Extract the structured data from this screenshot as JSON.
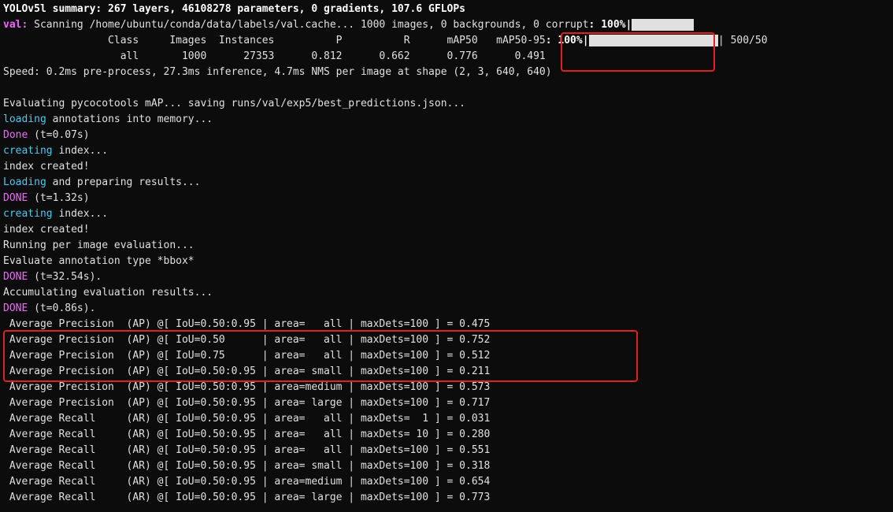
{
  "summary": "YOLOv5l summary: 267 layers, 46108278 parameters, 0 gradients, 107.6 GFLOPs",
  "val_label": "val: ",
  "val_line": "Scanning /home/ubuntu/conda/data/labels/val.cache... 1000 images, 0 backgrounds, 0 corrupt",
  "val_pct": ": 100%|",
  "hdr": "                 Class     Images  Instances          P          R      mAP50   mAP50-95",
  "hdr_pct": ": 100%|",
  "hdr_progtail": "| 500/50",
  "row_all": "                   all       1000      27353      0.812      0.662      0.776      0.491",
  "speed": "Speed: 0.2ms pre-process, 27.3ms inference, 4.7ms NMS per image at shape (2, 3, 640, 640)",
  "blank": "",
  "eval_msg": "Evaluating pycocotools mAP... saving runs/val/exp5/best_predictions.json...",
  "loading": "loading",
  "loading_rest": " annotations into memory...",
  "done": "Done",
  "done_t007": " (t=0.07s)",
  "creating": "creating",
  "creating_rest": " index...",
  "index_created": "index created!",
  "loading2": "Loading",
  "loading2_rest": " and preparing results...",
  "DONE": "DONE",
  "done_t132": " (t=1.32s)",
  "per_image": "Running per image evaluation...",
  "eval_anno": "Evaluate annotation type *bbox*",
  "done_t3254": " (t=32.54s).",
  "accum": "Accumulating evaluation results...",
  "done_t086": " (t=0.86s).",
  "ap": [
    " Average Precision  (AP) @[ IoU=0.50:0.95 | area=   all | maxDets=100 ] = 0.475",
    " Average Precision  (AP) @[ IoU=0.50      | area=   all | maxDets=100 ] = 0.752",
    " Average Precision  (AP) @[ IoU=0.75      | area=   all | maxDets=100 ] = 0.512",
    " Average Precision  (AP) @[ IoU=0.50:0.95 | area= small | maxDets=100 ] = 0.211",
    " Average Precision  (AP) @[ IoU=0.50:0.95 | area=medium | maxDets=100 ] = 0.573",
    " Average Precision  (AP) @[ IoU=0.50:0.95 | area= large | maxDets=100 ] = 0.717",
    " Average Recall     (AR) @[ IoU=0.50:0.95 | area=   all | maxDets=  1 ] = 0.031",
    " Average Recall     (AR) @[ IoU=0.50:0.95 | area=   all | maxDets= 10 ] = 0.280",
    " Average Recall     (AR) @[ IoU=0.50:0.95 | area=   all | maxDets=100 ] = 0.551",
    " Average Recall     (AR) @[ IoU=0.50:0.95 | area= small | maxDets=100 ] = 0.318",
    " Average Recall     (AR) @[ IoU=0.50:0.95 | area=medium | maxDets=100 ] = 0.654",
    " Average Recall     (AR) @[ IoU=0.50:0.95 | area= large | maxDets=100 ] = 0.773"
  ]
}
